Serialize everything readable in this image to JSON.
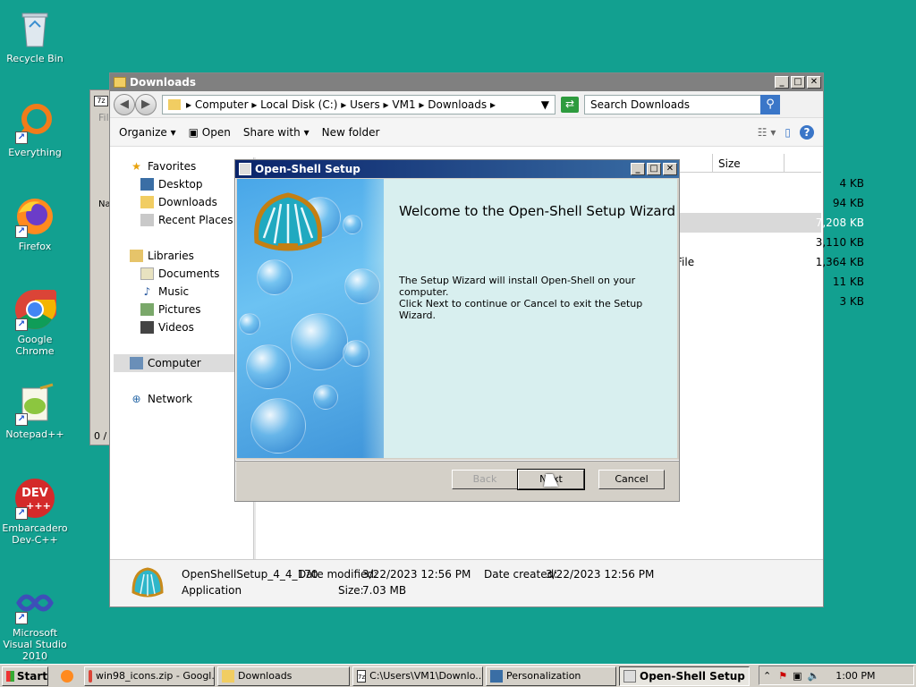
{
  "desktop": {
    "icons": [
      {
        "label": "Recycle Bin",
        "icon": "recycle-bin-icon"
      },
      {
        "label": "Everything",
        "icon": "everything-icon"
      },
      {
        "label": "Firefox",
        "icon": "firefox-icon"
      },
      {
        "label": "Google Chrome",
        "icon": "chrome-icon"
      },
      {
        "label": "Notepad++",
        "icon": "notepadpp-icon"
      },
      {
        "label": "Embarcadero Dev-C++",
        "icon": "devcpp-icon"
      },
      {
        "label": "Microsoft Visual Studio 2010",
        "icon": "visual-studio-icon"
      }
    ],
    "colors": {
      "background": "#12a090"
    }
  },
  "explorer": {
    "title": "Downloads",
    "breadcrumb": [
      "Computer",
      "Local Disk (C:)",
      "Users",
      "VM1",
      "Downloads"
    ],
    "search_placeholder": "Search Downloads",
    "toolbar": {
      "organize": "Organize",
      "open": "Open",
      "share": "Share with",
      "new_folder": "New folder"
    },
    "nav": {
      "favorites": "Favorites",
      "desktop": "Desktop",
      "downloads": "Downloads",
      "recent": "Recent Places",
      "libraries": "Libraries",
      "documents": "Documents",
      "music": "Music",
      "pictures": "Pictures",
      "videos": "Videos",
      "computer": "Computer",
      "network": "Network"
    },
    "columns": {
      "size": "Size"
    },
    "file_sizes": [
      "4 KB",
      "94 KB",
      "7,208 KB",
      "3,110 KB",
      "1,364 KB",
      "11 KB",
      "3 KB"
    ],
    "partial_type": "File",
    "details": {
      "filename": "OpenShellSetup_4_4_170",
      "date_modified_label": "Date modified:",
      "date_modified": "3/22/2023 12:56 PM",
      "date_created_label": "Date created:",
      "date_created": "3/22/2023 12:56 PM",
      "type": "Application",
      "size_label": "Size:",
      "size": "7.03 MB"
    }
  },
  "setup_dialog": {
    "title": "Open-Shell Setup",
    "heading": "Welcome to the Open-Shell Setup Wizard",
    "line1": "The Setup Wizard will install Open-Shell on your computer.",
    "line2": "Click Next to continue or Cancel to exit the Setup Wizard.",
    "buttons": {
      "back": "Back",
      "next": "Next",
      "cancel": "Cancel"
    }
  },
  "bg_window": {
    "label1": "File",
    "label2": "Na",
    "status": "0 /"
  },
  "taskbar": {
    "start": "Start",
    "tasks": [
      {
        "label": "win98_icons.zip - Googl...",
        "icon": "chrome-icon"
      },
      {
        "label": "Downloads",
        "icon": "folder-icon"
      },
      {
        "label": "C:\\Users\\VM1\\Downlo...",
        "icon": "7zip-icon"
      },
      {
        "label": "Personalization",
        "icon": "personalization-icon"
      },
      {
        "label": "Open-Shell Setup",
        "icon": "setup-icon"
      }
    ],
    "clock": "1:00 PM"
  }
}
